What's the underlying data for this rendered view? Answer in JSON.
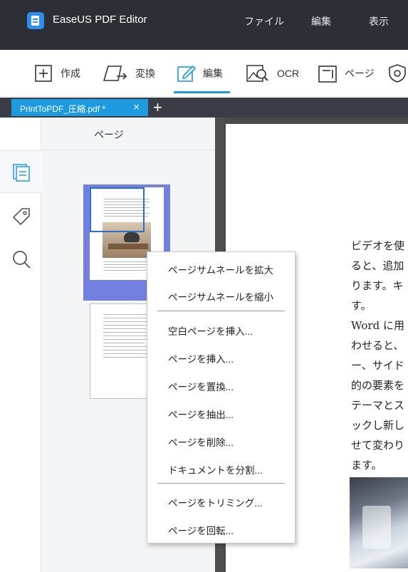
{
  "app": {
    "title": "EaseUS PDF Editor"
  },
  "menu": [
    "ファイル",
    "編集",
    "表示"
  ],
  "toolbar": {
    "items": [
      {
        "label": "作成",
        "icon": "plus-square-icon"
      },
      {
        "label": "変換",
        "icon": "convert-icon"
      },
      {
        "label": "編集",
        "icon": "edit-pencil-icon",
        "active": true
      },
      {
        "label": "OCR",
        "icon": "ocr-image-search-icon"
      },
      {
        "label": "ページ",
        "icon": "page-layout-icon"
      },
      {
        "label": "",
        "icon": "shield-icon"
      }
    ]
  },
  "tabs": [
    {
      "label": "PrintToPDF_圧縮.pdf *",
      "close": "×"
    }
  ],
  "tab_add": "+",
  "panel": {
    "title": "ページ"
  },
  "sidebar_icons": [
    "pages-icon",
    "tag-icon",
    "search-icon"
  ],
  "context_menu": {
    "items": [
      "ページサムネールを拡大",
      "ページサムネールを縮小",
      "空白ページを挿入...",
      "ページを挿入...",
      "ページを置換...",
      "ページを抽出...",
      "ページを削除...",
      "ドキュメントを分割...",
      "ページをトリミング...",
      "ページを回転..."
    ]
  },
  "document": {
    "lines": [
      "ビデオを使",
      "ると、追加",
      "ります。キ",
      "す。",
      "Word に用",
      "わせると、",
      "ー、サイド",
      "的の要素を",
      "テーマとス",
      "ックし新し",
      "せて変わり",
      "ます。"
    ]
  },
  "colors": {
    "accent": "#1e9be0",
    "titlebar": "#2c2f36",
    "selection": "#7480e0"
  }
}
